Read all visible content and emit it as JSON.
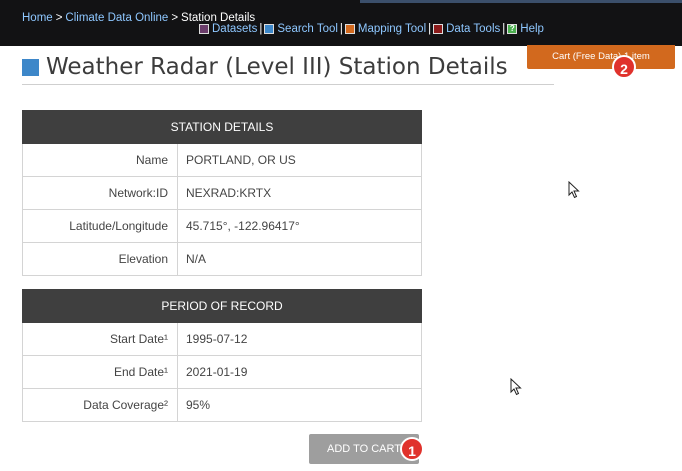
{
  "breadcrumb": {
    "home": "Home",
    "sep": ">",
    "cdo": "Climate Data Online",
    "current": "Station Details"
  },
  "toolnav": {
    "items": [
      {
        "label": "Datasets",
        "color": "#6b3d6b"
      },
      {
        "label": "Search Tool",
        "color": "#3d87c9"
      },
      {
        "label": "Mapping Tool",
        "color": "#d2691e"
      },
      {
        "label": "Data Tools",
        "color": "#8b1a1a"
      },
      {
        "label": "Help",
        "color": "#4caf50",
        "glyph": "?"
      }
    ]
  },
  "cart": {
    "label": "Cart (Free Data) 1 item"
  },
  "page": {
    "title": "Weather Radar (Level III) Station Details"
  },
  "station_details": {
    "header": "STATION DETAILS",
    "rows": [
      {
        "label": "Name",
        "value": "PORTLAND, OR US"
      },
      {
        "label": "Network:ID",
        "value": "NEXRAD:KRTX"
      },
      {
        "label": "Latitude/Longitude",
        "value": "45.715°, -122.96417°"
      },
      {
        "label": "Elevation",
        "value": "N/A"
      }
    ]
  },
  "period_of_record": {
    "header": "PERIOD OF RECORD",
    "rows": [
      {
        "label": "Start Date¹",
        "value": "1995-07-12"
      },
      {
        "label": "End Date¹",
        "value": "2021-01-19"
      },
      {
        "label": "Data Coverage²",
        "value": "95%"
      }
    ]
  },
  "actions": {
    "add_to_cart": "ADD TO CART"
  },
  "annotations": {
    "badge1": "1",
    "badge2": "2"
  }
}
